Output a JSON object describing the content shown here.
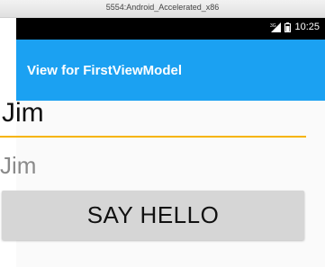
{
  "window": {
    "title": "5554:Android_Accelerated_x86"
  },
  "status_bar": {
    "network_label": "3G",
    "time": "10:25"
  },
  "app_bar": {
    "title": "View for FirstViewModel"
  },
  "main": {
    "name_input_value": "Jim",
    "echo_text": "Jim",
    "say_hello_label": "SAY HELLO"
  },
  "colors": {
    "app_bar": "#1ba1f2",
    "input_underline": "#f6b400",
    "button_bg": "#d6d6d6"
  }
}
